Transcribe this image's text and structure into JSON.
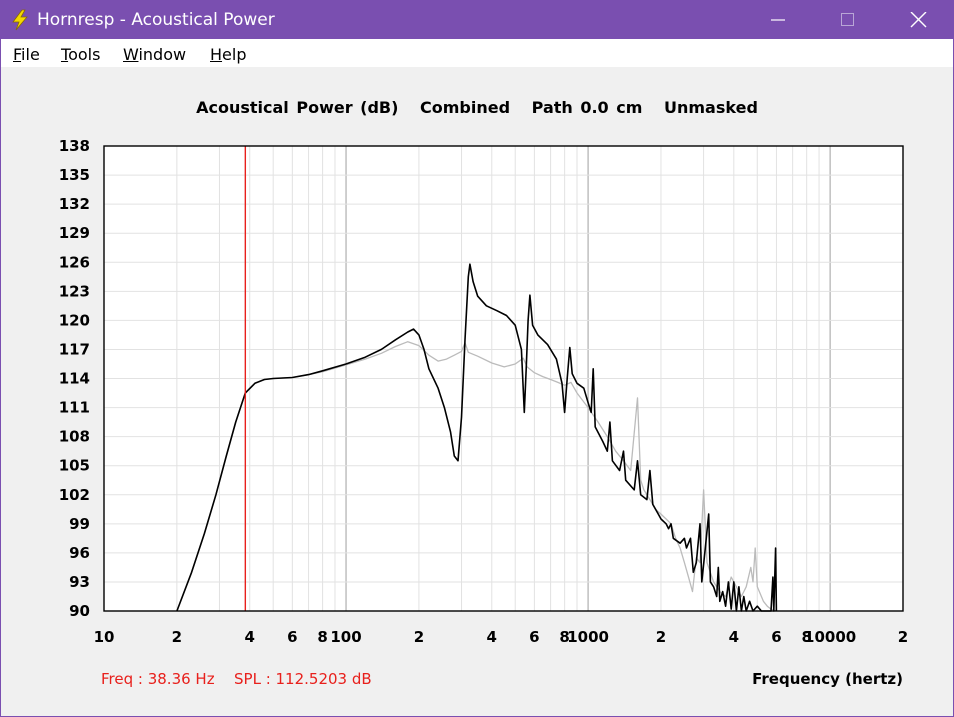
{
  "window": {
    "title": "Hornresp - Acoustical Power",
    "accent": "#7a4fb0",
    "icon": "lightning-bolt-icon",
    "controls": [
      "minimize-icon",
      "maximize-icon",
      "close-icon"
    ]
  },
  "menu": [
    {
      "key": "F",
      "rest": "ile"
    },
    {
      "key": "T",
      "rest": "ools"
    },
    {
      "key": "W",
      "rest": "indow"
    },
    {
      "key": "H",
      "rest": "elp"
    }
  ],
  "header": {
    "quantity": "Acoustical Power (dB)",
    "mode": "Combined",
    "path": "Path 0.0 cm",
    "mask": "Unmasked"
  },
  "status": {
    "freq": "Freq : 38.36 Hz",
    "spl": "SPL : 112.5203 dB"
  },
  "chart_data": {
    "type": "line",
    "xlabel": "Frequency (hertz)",
    "x_scale": "log",
    "xlim": [
      10,
      20000
    ],
    "ylim": [
      90,
      138
    ],
    "y_ticks": [
      138,
      135,
      132,
      129,
      126,
      123,
      120,
      117,
      114,
      111,
      108,
      105,
      102,
      99,
      96,
      93,
      90
    ],
    "x_tick_labels": [
      {
        "f": 10,
        "label": "10"
      },
      {
        "f": 20,
        "label": "2"
      },
      {
        "f": 40,
        "label": "4"
      },
      {
        "f": 60,
        "label": "6"
      },
      {
        "f": 80,
        "label": "8"
      },
      {
        "f": 100,
        "label": "100"
      },
      {
        "f": 200,
        "label": "2"
      },
      {
        "f": 400,
        "label": "4"
      },
      {
        "f": 600,
        "label": "6"
      },
      {
        "f": 800,
        "label": "8"
      },
      {
        "f": 1000,
        "label": "1000"
      },
      {
        "f": 2000,
        "label": "2"
      },
      {
        "f": 4000,
        "label": "4"
      },
      {
        "f": 6000,
        "label": "6"
      },
      {
        "f": 8000,
        "label": "8"
      },
      {
        "f": 10000,
        "label": "10000"
      },
      {
        "f": 20000,
        "label": "2"
      }
    ],
    "grid": true,
    "cursor": {
      "freq": 38.36,
      "color": "#e8201c"
    },
    "series": [
      {
        "color": "#000000",
        "points": [
          [
            20,
            90
          ],
          [
            23,
            94
          ],
          [
            26,
            98
          ],
          [
            29,
            102
          ],
          [
            32,
            106
          ],
          [
            35,
            109.5
          ],
          [
            38.36,
            112.5
          ],
          [
            42,
            113.5
          ],
          [
            46,
            113.9
          ],
          [
            50,
            114
          ],
          [
            60,
            114.1
          ],
          [
            70,
            114.4
          ],
          [
            80,
            114.8
          ],
          [
            100,
            115.5
          ],
          [
            120,
            116.2
          ],
          [
            140,
            117
          ],
          [
            160,
            118
          ],
          [
            180,
            118.8
          ],
          [
            190,
            119.1
          ],
          [
            200,
            118.5
          ],
          [
            210,
            117
          ],
          [
            220,
            115
          ],
          [
            240,
            113
          ],
          [
            255,
            111
          ],
          [
            270,
            108.5
          ],
          [
            280,
            106
          ],
          [
            290,
            105.5
          ],
          [
            300,
            110
          ],
          [
            310,
            118
          ],
          [
            320,
            124.5
          ],
          [
            325,
            125.8
          ],
          [
            335,
            124
          ],
          [
            350,
            122.5
          ],
          [
            380,
            121.5
          ],
          [
            420,
            121
          ],
          [
            460,
            120.5
          ],
          [
            500,
            119.5
          ],
          [
            530,
            117
          ],
          [
            545,
            110.5
          ],
          [
            555,
            115
          ],
          [
            565,
            120
          ],
          [
            575,
            122.6
          ],
          [
            590,
            119.5
          ],
          [
            620,
            118.5
          ],
          [
            680,
            117.5
          ],
          [
            740,
            116
          ],
          [
            780,
            113.5
          ],
          [
            800,
            110.5
          ],
          [
            820,
            114
          ],
          [
            840,
            117.2
          ],
          [
            860,
            114.5
          ],
          [
            900,
            113.5
          ],
          [
            960,
            113
          ],
          [
            1000,
            111.5
          ],
          [
            1030,
            110.5
          ],
          [
            1050,
            115
          ],
          [
            1070,
            109
          ],
          [
            1150,
            107.5
          ],
          [
            1200,
            106.5
          ],
          [
            1230,
            109.5
          ],
          [
            1260,
            105.5
          ],
          [
            1350,
            104.5
          ],
          [
            1400,
            106.5
          ],
          [
            1430,
            103.5
          ],
          [
            1550,
            102.5
          ],
          [
            1600,
            105.5
          ],
          [
            1650,
            102
          ],
          [
            1750,
            101.5
          ],
          [
            1800,
            104.5
          ],
          [
            1850,
            101
          ],
          [
            1950,
            100
          ],
          [
            2000,
            99.5
          ],
          [
            2100,
            99
          ],
          [
            2150,
            98.5
          ],
          [
            2200,
            99
          ],
          [
            2250,
            97.5
          ],
          [
            2400,
            97
          ],
          [
            2500,
            97.5
          ],
          [
            2550,
            96.5
          ],
          [
            2650,
            97.5
          ],
          [
            2720,
            94
          ],
          [
            2800,
            95
          ],
          [
            2900,
            99
          ],
          [
            2950,
            93
          ],
          [
            3050,
            96.5
          ],
          [
            3150,
            100
          ],
          [
            3200,
            93
          ],
          [
            3300,
            92.5
          ],
          [
            3400,
            91.5
          ],
          [
            3450,
            94.5
          ],
          [
            3500,
            91
          ],
          [
            3600,
            92
          ],
          [
            3700,
            90.5
          ],
          [
            3800,
            93
          ],
          [
            3900,
            90.2
          ],
          [
            4000,
            93
          ],
          [
            4100,
            90
          ],
          [
            4200,
            92.5
          ],
          [
            4300,
            90
          ],
          [
            4400,
            91.5
          ],
          [
            4500,
            90
          ],
          [
            4650,
            91
          ],
          [
            4800,
            90
          ],
          [
            5000,
            90.5
          ],
          [
            5200,
            90
          ],
          [
            5500,
            90
          ],
          [
            5700,
            90
          ],
          [
            5800,
            93.5
          ],
          [
            5850,
            90
          ],
          [
            5950,
            96.5
          ],
          [
            6000,
            90
          ]
        ]
      },
      {
        "color": "#bbbbbb",
        "points": [
          [
            20,
            90
          ],
          [
            23,
            94
          ],
          [
            26,
            98
          ],
          [
            29,
            102
          ],
          [
            32,
            106
          ],
          [
            35,
            109.5
          ],
          [
            38.36,
            112.5
          ],
          [
            42,
            113.5
          ],
          [
            46,
            113.9
          ],
          [
            50,
            114
          ],
          [
            60,
            114.1
          ],
          [
            70,
            114.4
          ],
          [
            80,
            114.7
          ],
          [
            100,
            115.4
          ],
          [
            120,
            116
          ],
          [
            140,
            116.6
          ],
          [
            160,
            117.3
          ],
          [
            180,
            117.8
          ],
          [
            200,
            117.4
          ],
          [
            220,
            116.4
          ],
          [
            240,
            115.8
          ],
          [
            260,
            116
          ],
          [
            280,
            116.4
          ],
          [
            300,
            116.8
          ],
          [
            310,
            117.7
          ],
          [
            320,
            116.7
          ],
          [
            350,
            116.3
          ],
          [
            400,
            115.6
          ],
          [
            450,
            115.2
          ],
          [
            500,
            115.5
          ],
          [
            540,
            116.1
          ],
          [
            560,
            115.2
          ],
          [
            600,
            114.6
          ],
          [
            650,
            114.2
          ],
          [
            700,
            113.9
          ],
          [
            750,
            113.6
          ],
          [
            800,
            113.3
          ],
          [
            850,
            113.6
          ],
          [
            900,
            112.5
          ],
          [
            1000,
            111
          ],
          [
            1100,
            109.5
          ],
          [
            1200,
            108
          ],
          [
            1300,
            106.5
          ],
          [
            1400,
            105.5
          ],
          [
            1500,
            104.5
          ],
          [
            1600,
            112
          ],
          [
            1650,
            103.5
          ],
          [
            1700,
            102.5
          ],
          [
            1800,
            101.5
          ],
          [
            1900,
            100.5
          ],
          [
            2000,
            100
          ],
          [
            2100,
            99.5
          ],
          [
            2200,
            99
          ],
          [
            2300,
            97.5
          ],
          [
            2400,
            96.5
          ],
          [
            2500,
            95
          ],
          [
            2600,
            93.5
          ],
          [
            2700,
            92
          ],
          [
            2800,
            95.5
          ],
          [
            2900,
            95
          ],
          [
            3000,
            102.5
          ],
          [
            3100,
            95
          ],
          [
            3300,
            93
          ],
          [
            3500,
            92
          ],
          [
            3700,
            91.5
          ],
          [
            3900,
            93.5
          ],
          [
            4100,
            92.5
          ],
          [
            4300,
            91.5
          ],
          [
            4500,
            92.5
          ],
          [
            4700,
            94.5
          ],
          [
            4800,
            93
          ],
          [
            4900,
            96.5
          ],
          [
            5000,
            92.5
          ],
          [
            5300,
            91
          ],
          [
            5500,
            90.5
          ],
          [
            5700,
            90.2
          ],
          [
            6000,
            90
          ]
        ]
      }
    ]
  }
}
